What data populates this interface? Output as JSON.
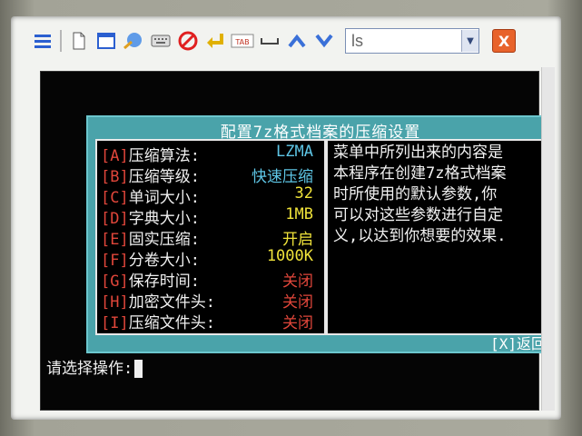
{
  "toolbar": {
    "icons": [
      "menu-icon",
      "new-doc-icon",
      "window-icon",
      "connect-icon",
      "keyboard-icon",
      "stop-icon",
      "enter-icon",
      "tab-icon",
      "space-icon",
      "up-arrow-icon",
      "down-arrow-icon"
    ],
    "tab_label": "TAB",
    "combo_value": "ls",
    "combo_arrow": "▼",
    "close_label": "X"
  },
  "dialog": {
    "title": "配置7z格式档案的压缩设置",
    "options": [
      {
        "key": "[A]",
        "label": "压缩算法:",
        "value": "LZMA",
        "color": "#5ec6e6"
      },
      {
        "key": "[B]",
        "label": "压缩等级:",
        "value": "快速压缩",
        "color": "#5ec6e6"
      },
      {
        "key": "[C]",
        "label": "单词大小:",
        "value": "32",
        "color": "#f0e33a"
      },
      {
        "key": "[D]",
        "label": "字典大小:",
        "value": "1MB",
        "color": "#f0e33a"
      },
      {
        "key": "[E]",
        "label": "固实压缩:",
        "value": "开启",
        "color": "#f0e33a"
      },
      {
        "key": "[F]",
        "label": "分卷大小:",
        "value": "1000K",
        "color": "#f0e33a"
      },
      {
        "key": "[G]",
        "label": "保存时间:",
        "value": "关闭",
        "color": "#e0463a"
      },
      {
        "key": "[H]",
        "label": "加密文件头:",
        "value": "关闭",
        "color": "#e0463a"
      },
      {
        "key": "[I]",
        "label": "压缩文件头:",
        "value": "关闭",
        "color": "#e0463a"
      }
    ],
    "description": "菜单中所列出来的内容是\n本程序在创建7z格式档案\n时所使用的默认参数,你\n可以对这些参数进行自定\n义,以达到你想要的效果.",
    "back_key": "[X]",
    "back_label": "返回"
  },
  "prompt": "请选择操作:"
}
